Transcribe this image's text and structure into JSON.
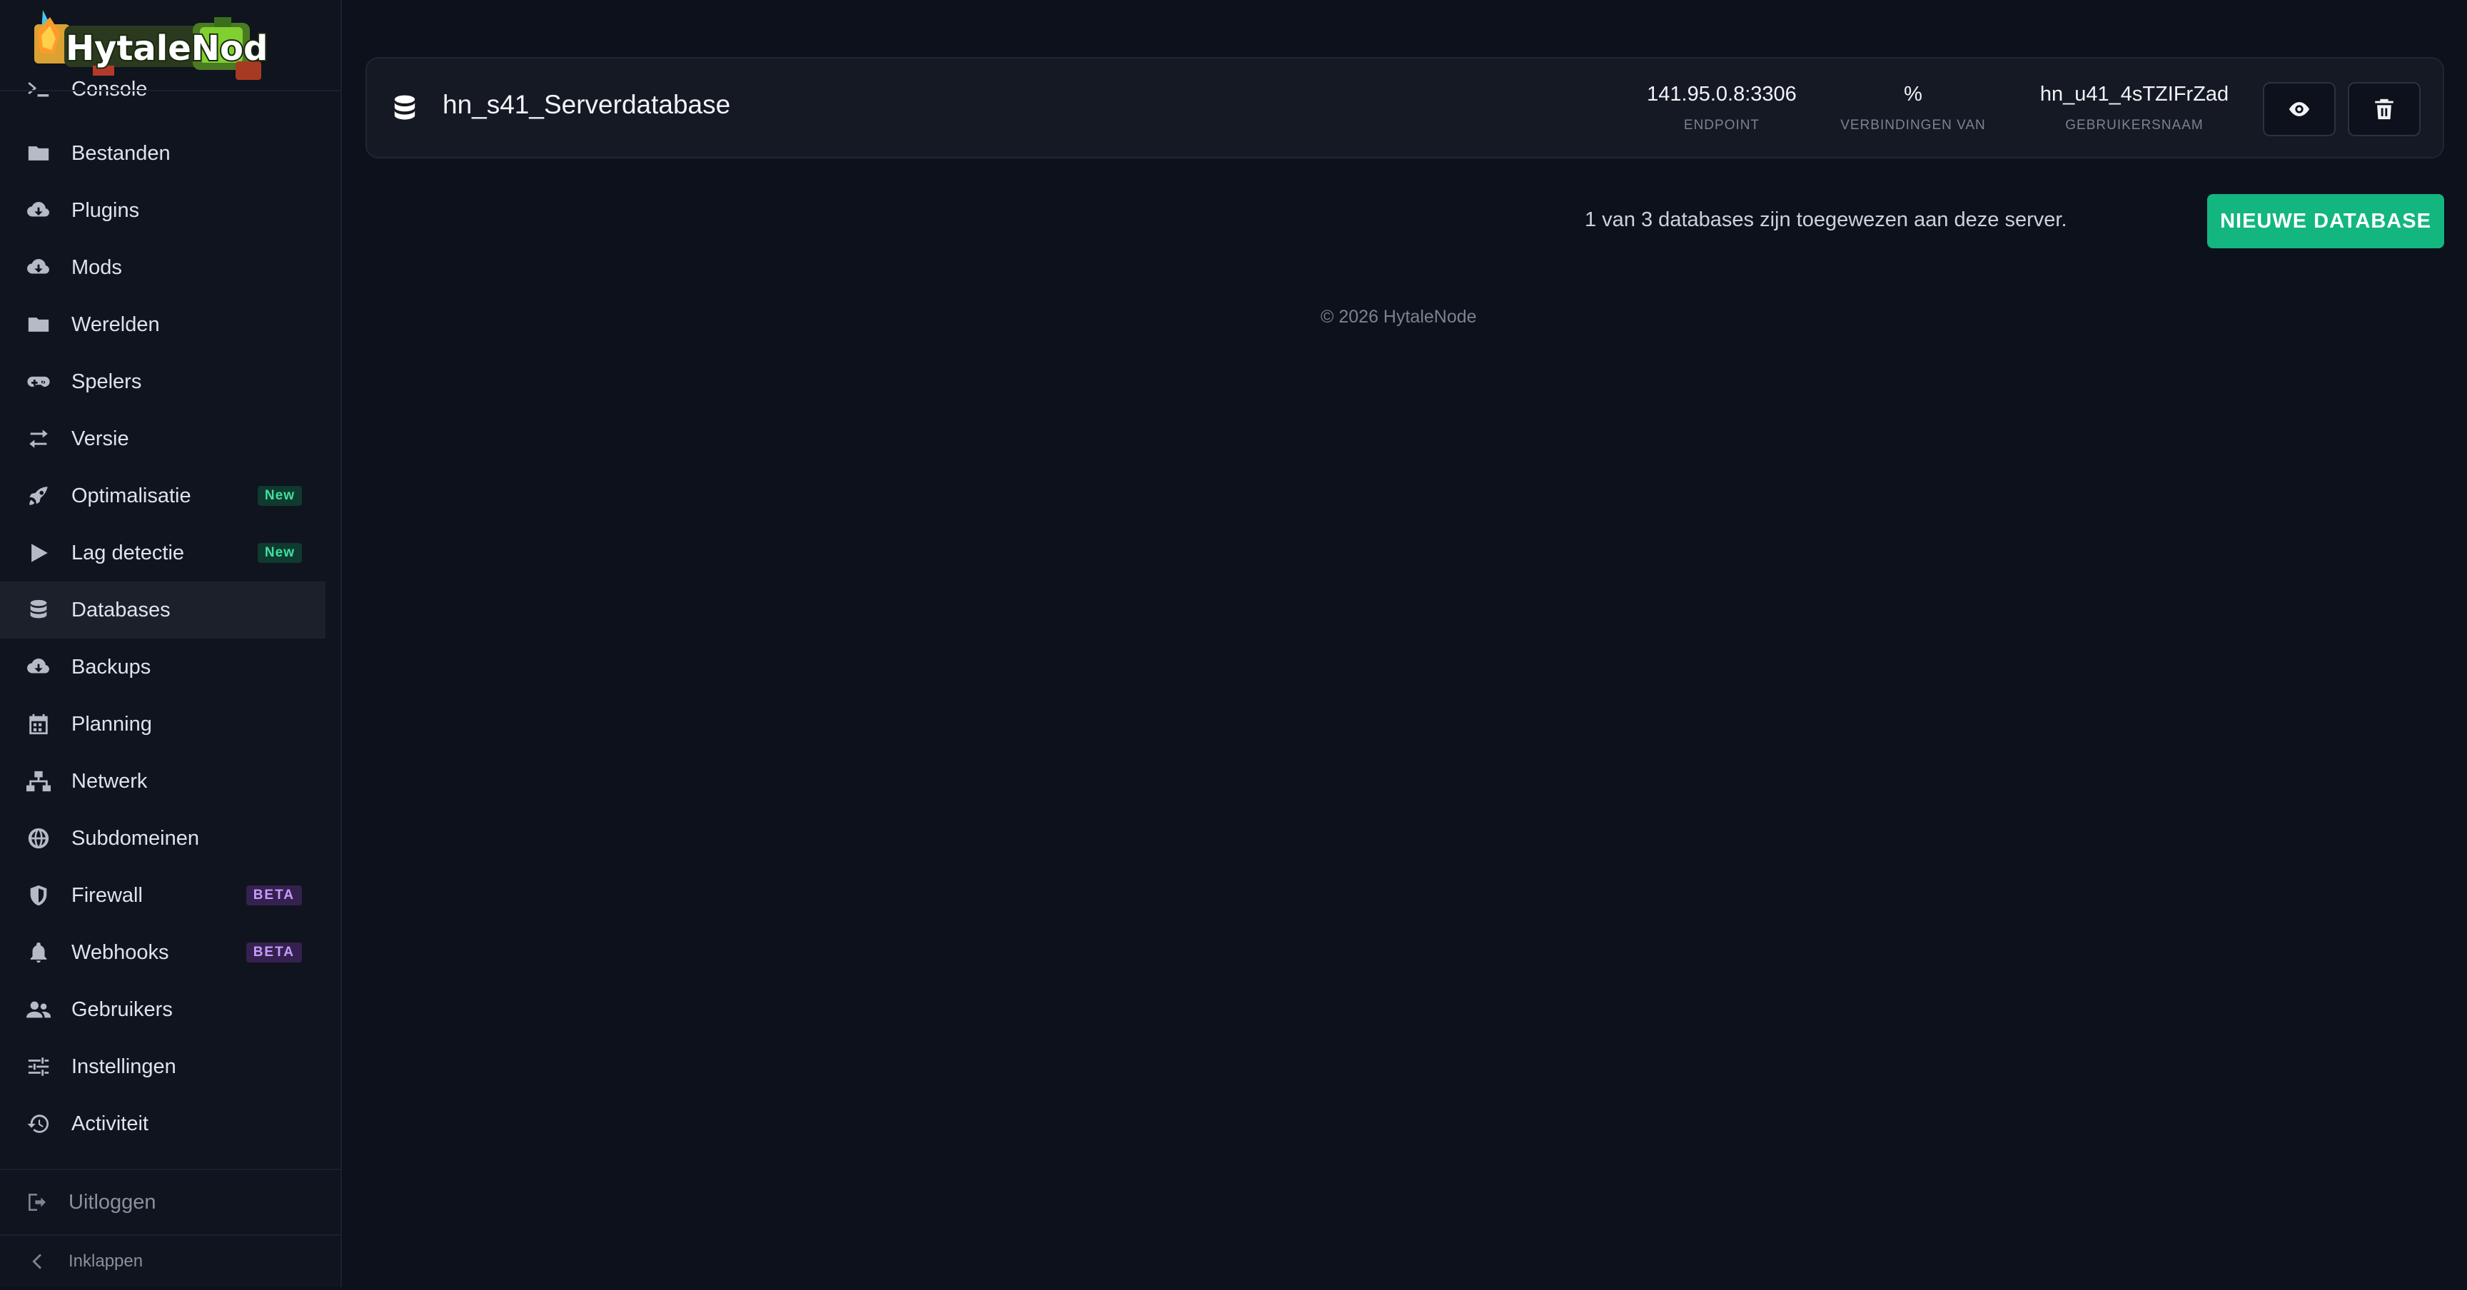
{
  "brand": {
    "logo_text": "HytaleNode"
  },
  "sidebar": {
    "items": [
      {
        "label": "Console",
        "icon": "terminal-icon"
      },
      {
        "label": "Bestanden",
        "icon": "folder-icon"
      },
      {
        "label": "Plugins",
        "icon": "cloud-download-icon"
      },
      {
        "label": "Mods",
        "icon": "cloud-download-icon"
      },
      {
        "label": "Werelden",
        "icon": "folder-icon"
      },
      {
        "label": "Spelers",
        "icon": "gamepad-icon"
      },
      {
        "label": "Versie",
        "icon": "swap-arrows-icon"
      },
      {
        "label": "Optimalisatie",
        "icon": "rocket-icon",
        "badge": "New"
      },
      {
        "label": "Lag detectie",
        "icon": "play-icon",
        "badge": "New"
      },
      {
        "label": "Databases",
        "icon": "database-icon",
        "active": true
      },
      {
        "label": "Backups",
        "icon": "cloud-download-icon"
      },
      {
        "label": "Planning",
        "icon": "calendar-icon"
      },
      {
        "label": "Netwerk",
        "icon": "network-icon"
      },
      {
        "label": "Subdomeinen",
        "icon": "globe-icon"
      },
      {
        "label": "Firewall",
        "icon": "shield-icon",
        "badge": "BETA"
      },
      {
        "label": "Webhooks",
        "icon": "bell-icon",
        "badge": "BETA"
      },
      {
        "label": "Gebruikers",
        "icon": "users-icon"
      },
      {
        "label": "Instellingen",
        "icon": "sliders-icon"
      },
      {
        "label": "Activiteit",
        "icon": "history-icon"
      }
    ],
    "logout_label": "Uitloggen",
    "collapse_label": "Inklappen"
  },
  "database": {
    "name": "hn_s41_Serverdatabase",
    "endpoint_value": "141.95.0.8:3306",
    "endpoint_caption": "ENDPOINT",
    "connections_value": "%",
    "connections_caption": "VERBINDINGEN VAN",
    "username_value": "hn_u41_4sTZIFrZad",
    "username_caption": "GEBRUIKERSNAAM"
  },
  "info_text": "1 van 3 databases zijn toegewezen aan deze server.",
  "new_database_label": "NIEUWE DATABASE",
  "footer_text": "© 2026 HytaleNode",
  "colors": {
    "accent": "#13b67f",
    "background": "#0d111b",
    "sidebar": "#0f141e"
  }
}
